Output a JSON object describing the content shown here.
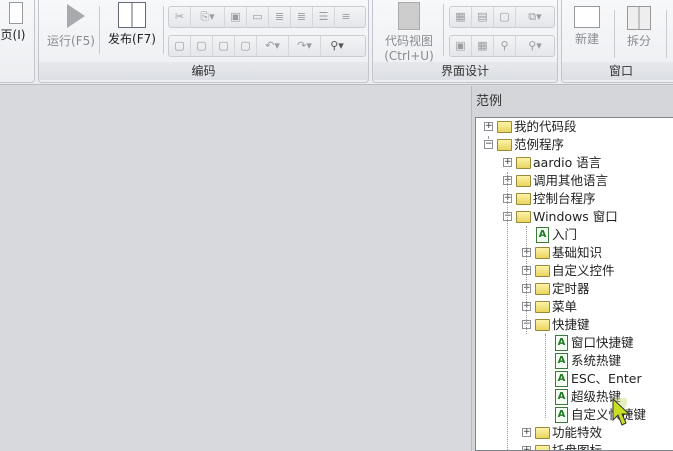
{
  "ribbon": {
    "partial_group": {
      "button": "页(I)"
    },
    "coding": {
      "label": "编码",
      "run": "运行(F5)",
      "publish": "发布(F7)"
    },
    "ui_design": {
      "label": "界面设计",
      "code_view": "代码视图",
      "code_view_shortcut": "(Ctrl+U)"
    },
    "window": {
      "label": "窗口",
      "new": "新建",
      "split": "拆分"
    }
  },
  "panel": {
    "title": "范例",
    "tree": [
      {
        "label": "我的代码段",
        "level": 0,
        "type": "folder",
        "expanded": false
      },
      {
        "label": "范例程序",
        "level": 0,
        "type": "folder",
        "expanded": true
      },
      {
        "label": "aardio 语言",
        "level": 1,
        "type": "folder",
        "expanded": false
      },
      {
        "label": "调用其他语言",
        "level": 1,
        "type": "folder",
        "expanded": false
      },
      {
        "label": "控制台程序",
        "level": 1,
        "type": "folder",
        "expanded": false
      },
      {
        "label": "Windows 窗口",
        "level": 1,
        "type": "folder",
        "expanded": true
      },
      {
        "label": "入门",
        "level": 2,
        "type": "file"
      },
      {
        "label": "基础知识",
        "level": 2,
        "type": "folder",
        "expanded": false
      },
      {
        "label": "自定义控件",
        "level": 2,
        "type": "folder",
        "expanded": false
      },
      {
        "label": "定时器",
        "level": 2,
        "type": "folder",
        "expanded": false
      },
      {
        "label": "菜单",
        "level": 2,
        "type": "folder",
        "expanded": false
      },
      {
        "label": "快捷键",
        "level": 2,
        "type": "folder",
        "expanded": true
      },
      {
        "label": "窗口快捷键",
        "level": 3,
        "type": "file"
      },
      {
        "label": "系统热键",
        "level": 3,
        "type": "file"
      },
      {
        "label": "ESC、Enter",
        "level": 3,
        "type": "file"
      },
      {
        "label": "超级热键",
        "level": 3,
        "type": "file"
      },
      {
        "label": "自定义快捷键",
        "level": 3,
        "type": "file"
      },
      {
        "label": "功能特效",
        "level": 2,
        "type": "folder",
        "expanded": false
      },
      {
        "label": "托盘图标",
        "level": 2,
        "type": "folder",
        "expanded": false
      }
    ]
  }
}
